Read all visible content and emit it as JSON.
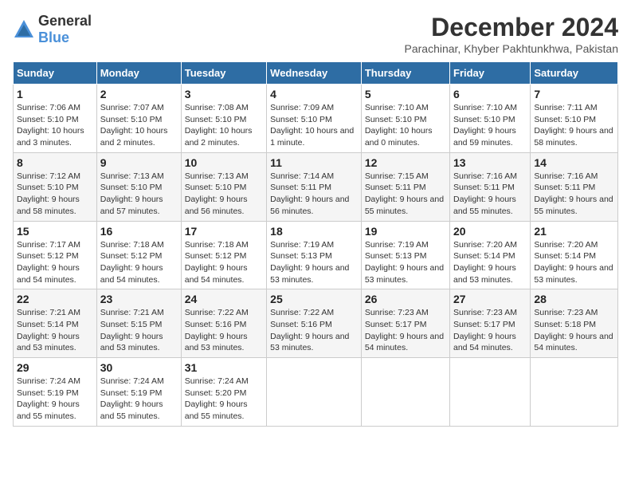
{
  "logo": {
    "general": "General",
    "blue": "Blue"
  },
  "title": "December 2024",
  "subtitle": "Parachinar, Khyber Pakhtunkhwa, Pakistan",
  "days_of_week": [
    "Sunday",
    "Monday",
    "Tuesday",
    "Wednesday",
    "Thursday",
    "Friday",
    "Saturday"
  ],
  "weeks": [
    [
      {
        "day": "1",
        "sunrise": "7:06 AM",
        "sunset": "5:10 PM",
        "daylight": "10 hours and 3 minutes."
      },
      {
        "day": "2",
        "sunrise": "7:07 AM",
        "sunset": "5:10 PM",
        "daylight": "10 hours and 2 minutes."
      },
      {
        "day": "3",
        "sunrise": "7:08 AM",
        "sunset": "5:10 PM",
        "daylight": "10 hours and 2 minutes."
      },
      {
        "day": "4",
        "sunrise": "7:09 AM",
        "sunset": "5:10 PM",
        "daylight": "10 hours and 1 minute."
      },
      {
        "day": "5",
        "sunrise": "7:10 AM",
        "sunset": "5:10 PM",
        "daylight": "10 hours and 0 minutes."
      },
      {
        "day": "6",
        "sunrise": "7:10 AM",
        "sunset": "5:10 PM",
        "daylight": "9 hours and 59 minutes."
      },
      {
        "day": "7",
        "sunrise": "7:11 AM",
        "sunset": "5:10 PM",
        "daylight": "9 hours and 58 minutes."
      }
    ],
    [
      {
        "day": "8",
        "sunrise": "7:12 AM",
        "sunset": "5:10 PM",
        "daylight": "9 hours and 58 minutes."
      },
      {
        "day": "9",
        "sunrise": "7:13 AM",
        "sunset": "5:10 PM",
        "daylight": "9 hours and 57 minutes."
      },
      {
        "day": "10",
        "sunrise": "7:13 AM",
        "sunset": "5:10 PM",
        "daylight": "9 hours and 56 minutes."
      },
      {
        "day": "11",
        "sunrise": "7:14 AM",
        "sunset": "5:11 PM",
        "daylight": "9 hours and 56 minutes."
      },
      {
        "day": "12",
        "sunrise": "7:15 AM",
        "sunset": "5:11 PM",
        "daylight": "9 hours and 55 minutes."
      },
      {
        "day": "13",
        "sunrise": "7:16 AM",
        "sunset": "5:11 PM",
        "daylight": "9 hours and 55 minutes."
      },
      {
        "day": "14",
        "sunrise": "7:16 AM",
        "sunset": "5:11 PM",
        "daylight": "9 hours and 55 minutes."
      }
    ],
    [
      {
        "day": "15",
        "sunrise": "7:17 AM",
        "sunset": "5:12 PM",
        "daylight": "9 hours and 54 minutes."
      },
      {
        "day": "16",
        "sunrise": "7:18 AM",
        "sunset": "5:12 PM",
        "daylight": "9 hours and 54 minutes."
      },
      {
        "day": "17",
        "sunrise": "7:18 AM",
        "sunset": "5:12 PM",
        "daylight": "9 hours and 54 minutes."
      },
      {
        "day": "18",
        "sunrise": "7:19 AM",
        "sunset": "5:13 PM",
        "daylight": "9 hours and 53 minutes."
      },
      {
        "day": "19",
        "sunrise": "7:19 AM",
        "sunset": "5:13 PM",
        "daylight": "9 hours and 53 minutes."
      },
      {
        "day": "20",
        "sunrise": "7:20 AM",
        "sunset": "5:14 PM",
        "daylight": "9 hours and 53 minutes."
      },
      {
        "day": "21",
        "sunrise": "7:20 AM",
        "sunset": "5:14 PM",
        "daylight": "9 hours and 53 minutes."
      }
    ],
    [
      {
        "day": "22",
        "sunrise": "7:21 AM",
        "sunset": "5:14 PM",
        "daylight": "9 hours and 53 minutes."
      },
      {
        "day": "23",
        "sunrise": "7:21 AM",
        "sunset": "5:15 PM",
        "daylight": "9 hours and 53 minutes."
      },
      {
        "day": "24",
        "sunrise": "7:22 AM",
        "sunset": "5:16 PM",
        "daylight": "9 hours and 53 minutes."
      },
      {
        "day": "25",
        "sunrise": "7:22 AM",
        "sunset": "5:16 PM",
        "daylight": "9 hours and 53 minutes."
      },
      {
        "day": "26",
        "sunrise": "7:23 AM",
        "sunset": "5:17 PM",
        "daylight": "9 hours and 54 minutes."
      },
      {
        "day": "27",
        "sunrise": "7:23 AM",
        "sunset": "5:17 PM",
        "daylight": "9 hours and 54 minutes."
      },
      {
        "day": "28",
        "sunrise": "7:23 AM",
        "sunset": "5:18 PM",
        "daylight": "9 hours and 54 minutes."
      }
    ],
    [
      {
        "day": "29",
        "sunrise": "7:24 AM",
        "sunset": "5:19 PM",
        "daylight": "9 hours and 55 minutes."
      },
      {
        "day": "30",
        "sunrise": "7:24 AM",
        "sunset": "5:19 PM",
        "daylight": "9 hours and 55 minutes."
      },
      {
        "day": "31",
        "sunrise": "7:24 AM",
        "sunset": "5:20 PM",
        "daylight": "9 hours and 55 minutes."
      },
      null,
      null,
      null,
      null
    ]
  ],
  "labels": {
    "sunrise": "Sunrise:",
    "sunset": "Sunset:",
    "daylight": "Daylight:"
  }
}
